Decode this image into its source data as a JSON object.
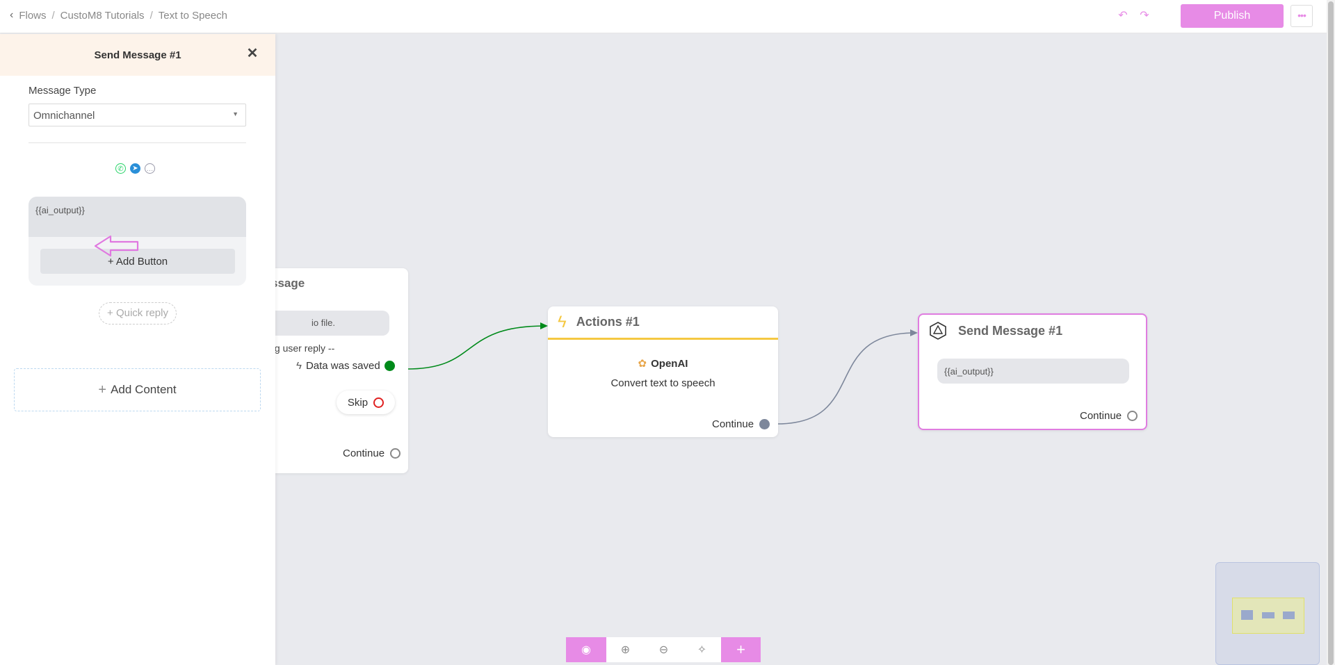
{
  "breadcrumb": {
    "items": [
      "Flows",
      "CustoM8 Tutorials",
      "Text to Speech"
    ]
  },
  "header": {
    "publish_label": "Publish",
    "more_label": "•••"
  },
  "panel": {
    "title": "Send Message #1",
    "message_type_label": "Message Type",
    "message_type_value": "Omnichannel",
    "message_text": "{{ai_output}}",
    "add_button_label": "+ Add Button",
    "quick_reply_label": "+ Quick reply",
    "add_content_label": "Add Content"
  },
  "nodes": {
    "partial": {
      "title": "ssage",
      "pill_text": "io file.",
      "reply_text": "ing user reply --",
      "saved_text": "Data was saved",
      "skip_label": "Skip",
      "continue_label": "Continue"
    },
    "actions": {
      "title": "Actions #1",
      "provider": "OpenAI",
      "description": "Convert text to speech",
      "continue_label": "Continue"
    },
    "send": {
      "title": "Send Message #1",
      "pill_text": "{{ai_output}}",
      "continue_label": "Continue"
    }
  },
  "colors": {
    "accent": "#e78be6",
    "actions_border": "#f5c842",
    "edge_green": "#008a1a",
    "edge_grey": "#7d879b"
  }
}
